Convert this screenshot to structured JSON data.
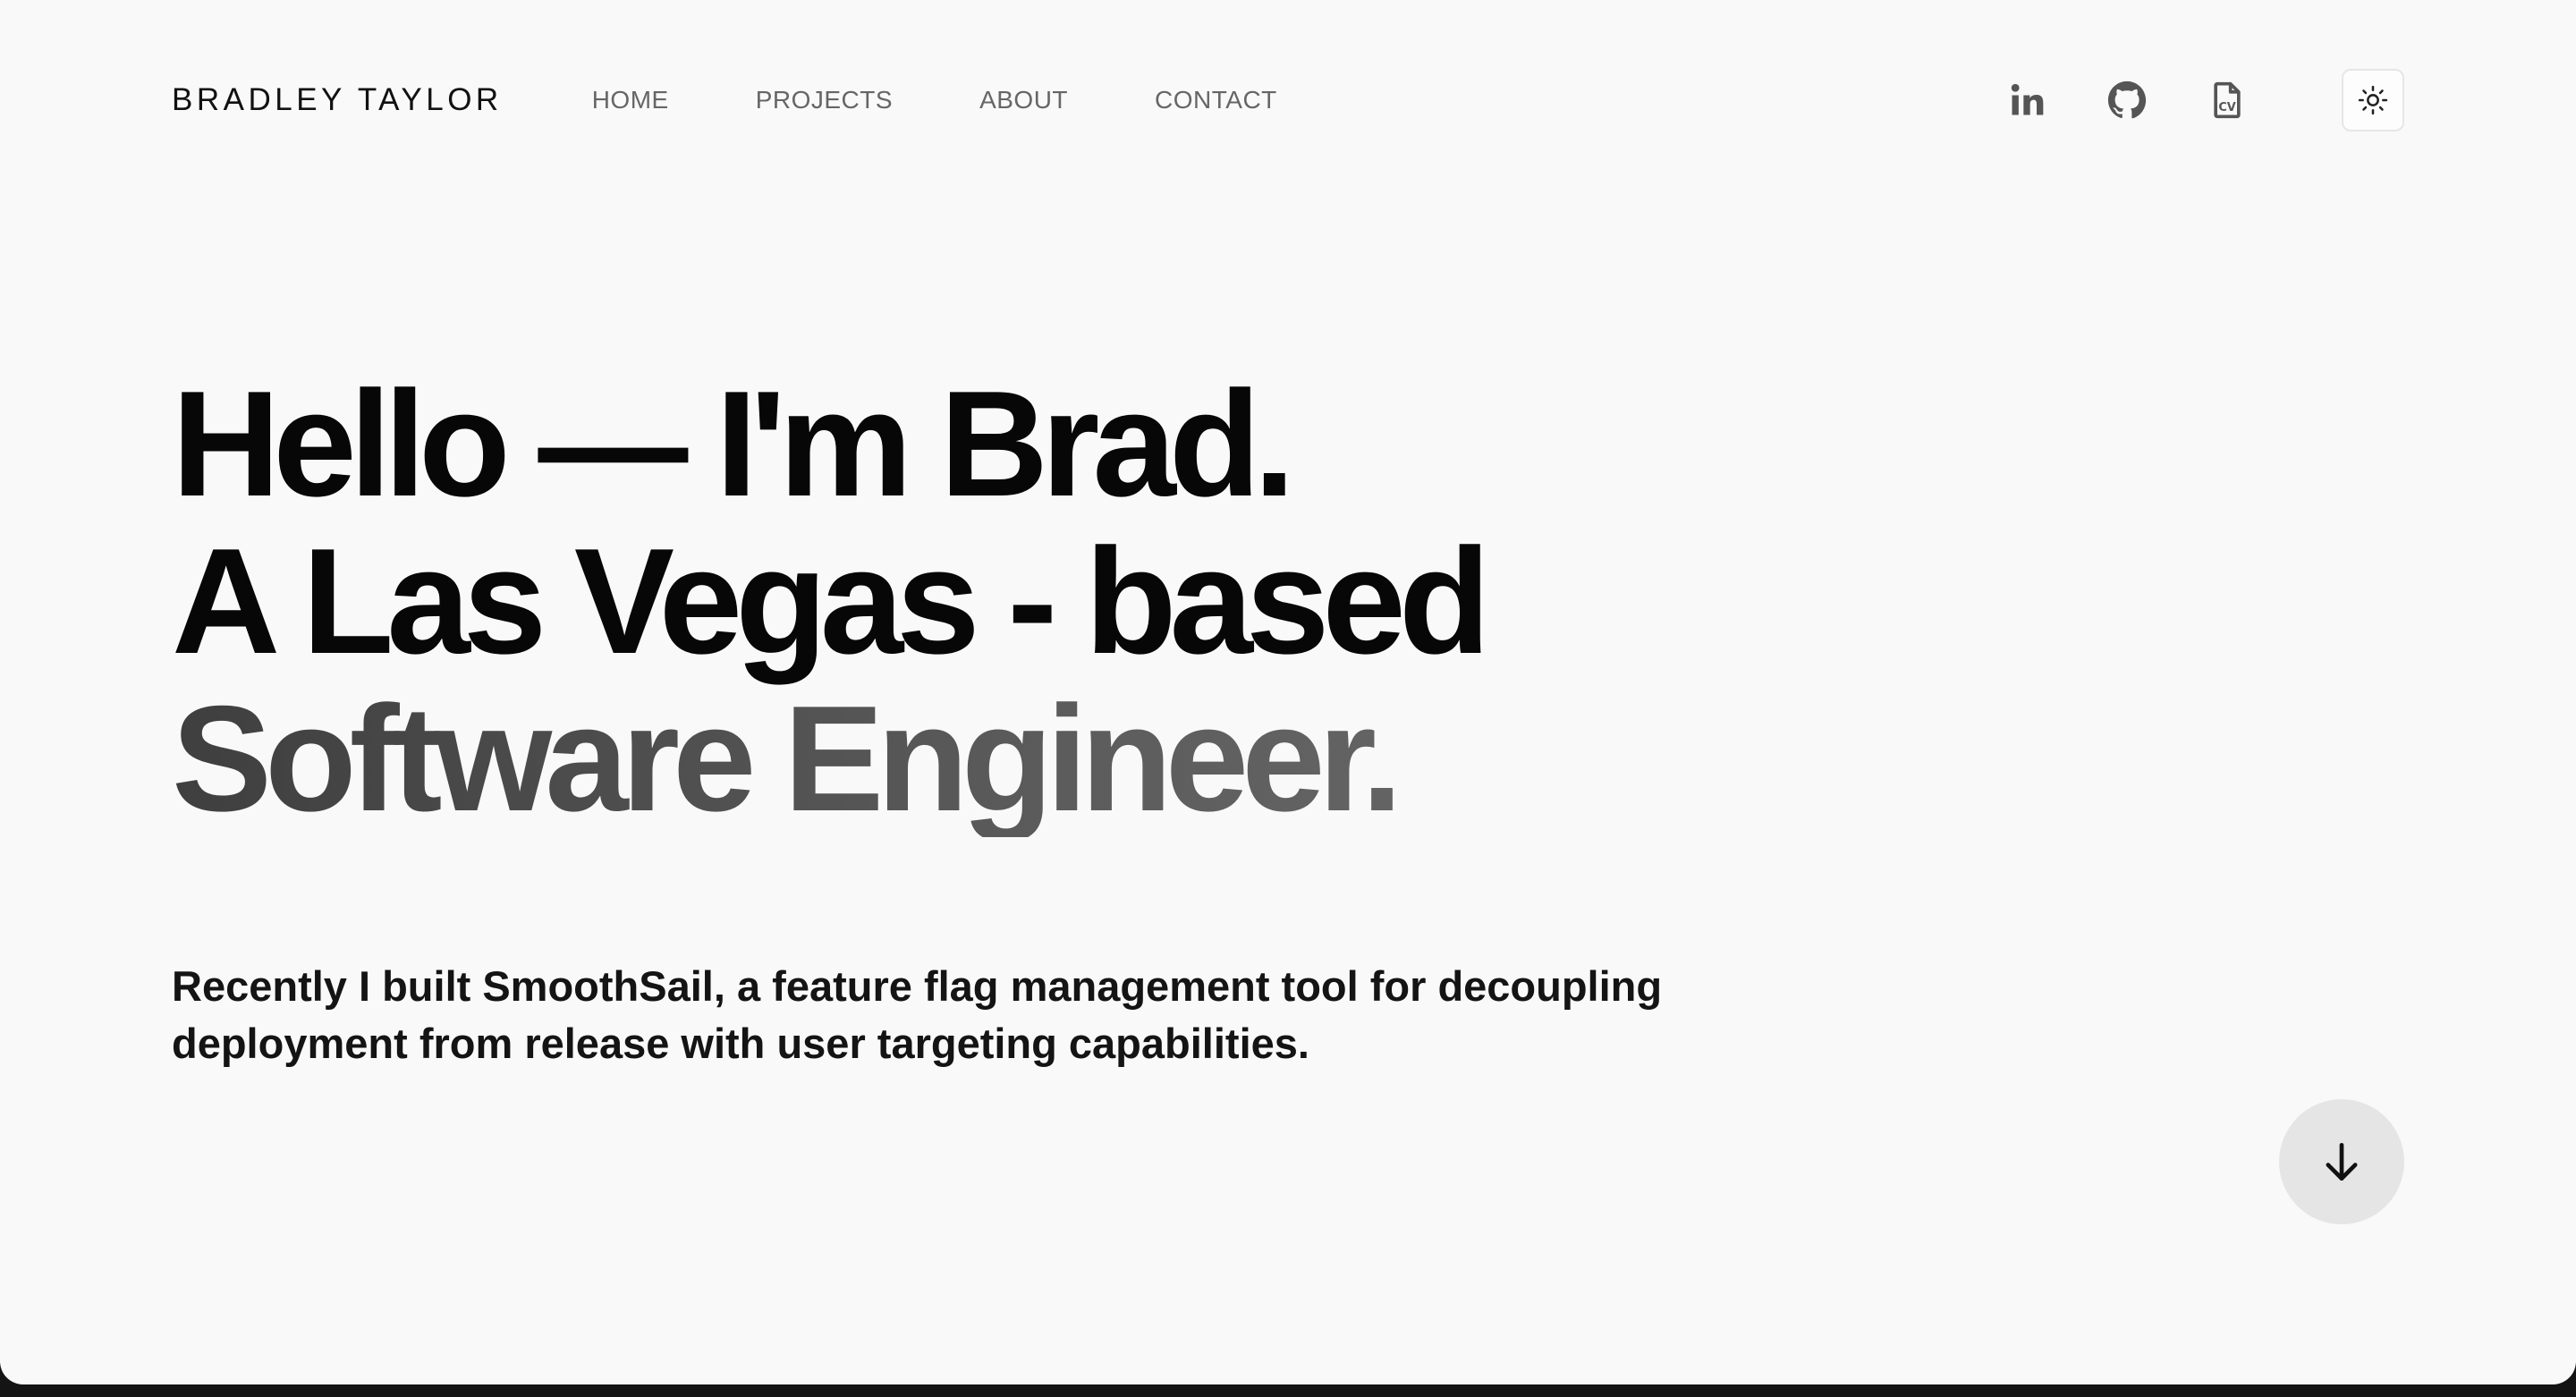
{
  "header": {
    "brand": "BRADLEY TAYLOR",
    "nav": [
      {
        "label": "HOME"
      },
      {
        "label": "PROJECTS"
      },
      {
        "label": "ABOUT"
      },
      {
        "label": "CONTACT"
      }
    ],
    "socials": [
      {
        "icon": "linkedin-icon"
      },
      {
        "icon": "github-icon"
      },
      {
        "icon": "cv-document-icon",
        "text": "CV"
      }
    ],
    "theme_toggle_icon": "sun-icon"
  },
  "hero": {
    "line1": "Hello — I'm Brad.",
    "line2": "A Las Vegas - based",
    "line3": "Software Engineer.",
    "intro": "Recently I built SmoothSail, a feature flag management tool for decoupling deployment from release with user targeting capabilities."
  },
  "scroll_button_icon": "arrow-down-icon",
  "colors": {
    "background": "#f9f9f9",
    "text": "#070707",
    "muted": "#666666",
    "gradient_start": "#3f3f3f",
    "gradient_end": "#6e6e6e",
    "button_bg": "#e5e5e5"
  }
}
